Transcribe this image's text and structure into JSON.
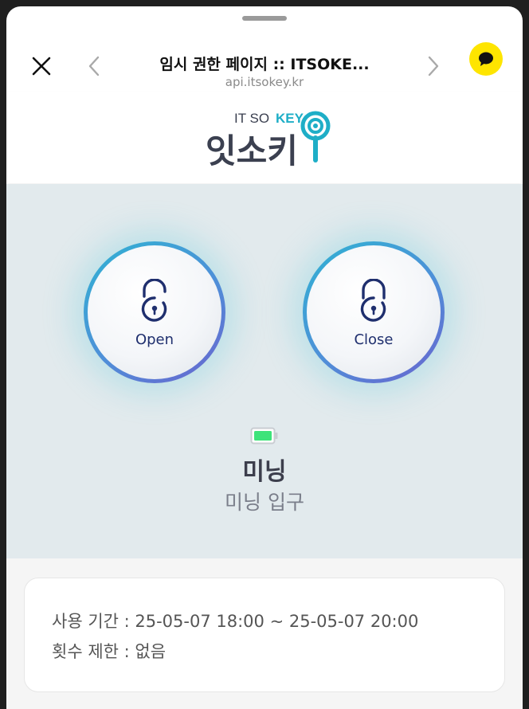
{
  "header": {
    "title": "임시 권한 페이지 :: ITSOKE...",
    "url": "api.itsokey.kr"
  },
  "logo": {
    "top_text_a": "IT SO ",
    "top_text_b": "KEY",
    "main_text": "잇소키"
  },
  "controls": {
    "open_label": "Open",
    "close_label": "Close"
  },
  "device": {
    "name": "미닝",
    "location": "미닝 입구",
    "battery_color": "#3ee37a"
  },
  "info": {
    "period": "사용 기간 : 25-05-07 18:00 ~ 25-05-07 20:00",
    "limit": "횟수 제한 : 없음"
  },
  "colors": {
    "accent": "#2fb3d3",
    "kakao": "#fee500",
    "panel_bg": "#e2eaed"
  }
}
